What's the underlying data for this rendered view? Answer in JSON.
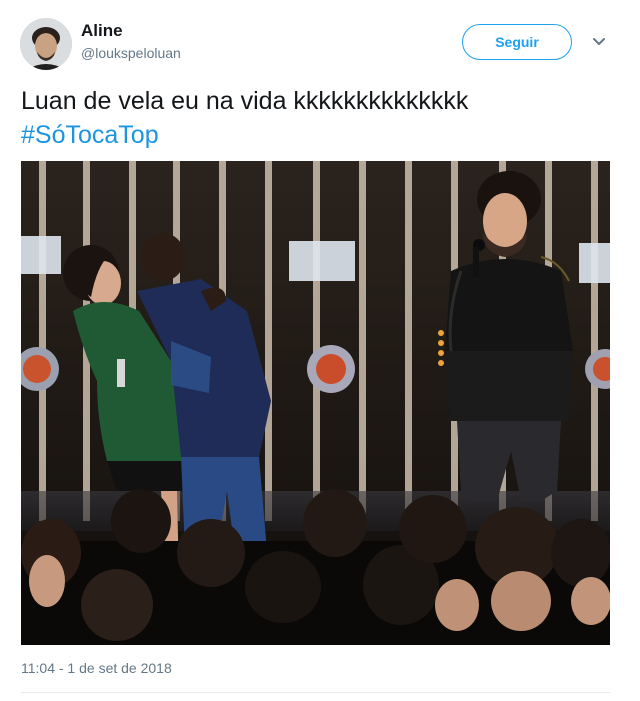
{
  "author": {
    "name": "Aline",
    "handle": "@loukspeloluan"
  },
  "actions": {
    "follow_label": "Seguir",
    "more_icon": "chevron-down-icon"
  },
  "tweet": {
    "text": "Luan de vela eu na vida kkkkkkkkkkkkkk",
    "hashtag": "#SóTocaTop",
    "timestamp": "11:04 - 1 de set de 2018"
  },
  "colors": {
    "accent": "#1da1f2",
    "hashtag": "#1b95e0",
    "muted": "#657786",
    "divider": "#e6ecf0"
  }
}
